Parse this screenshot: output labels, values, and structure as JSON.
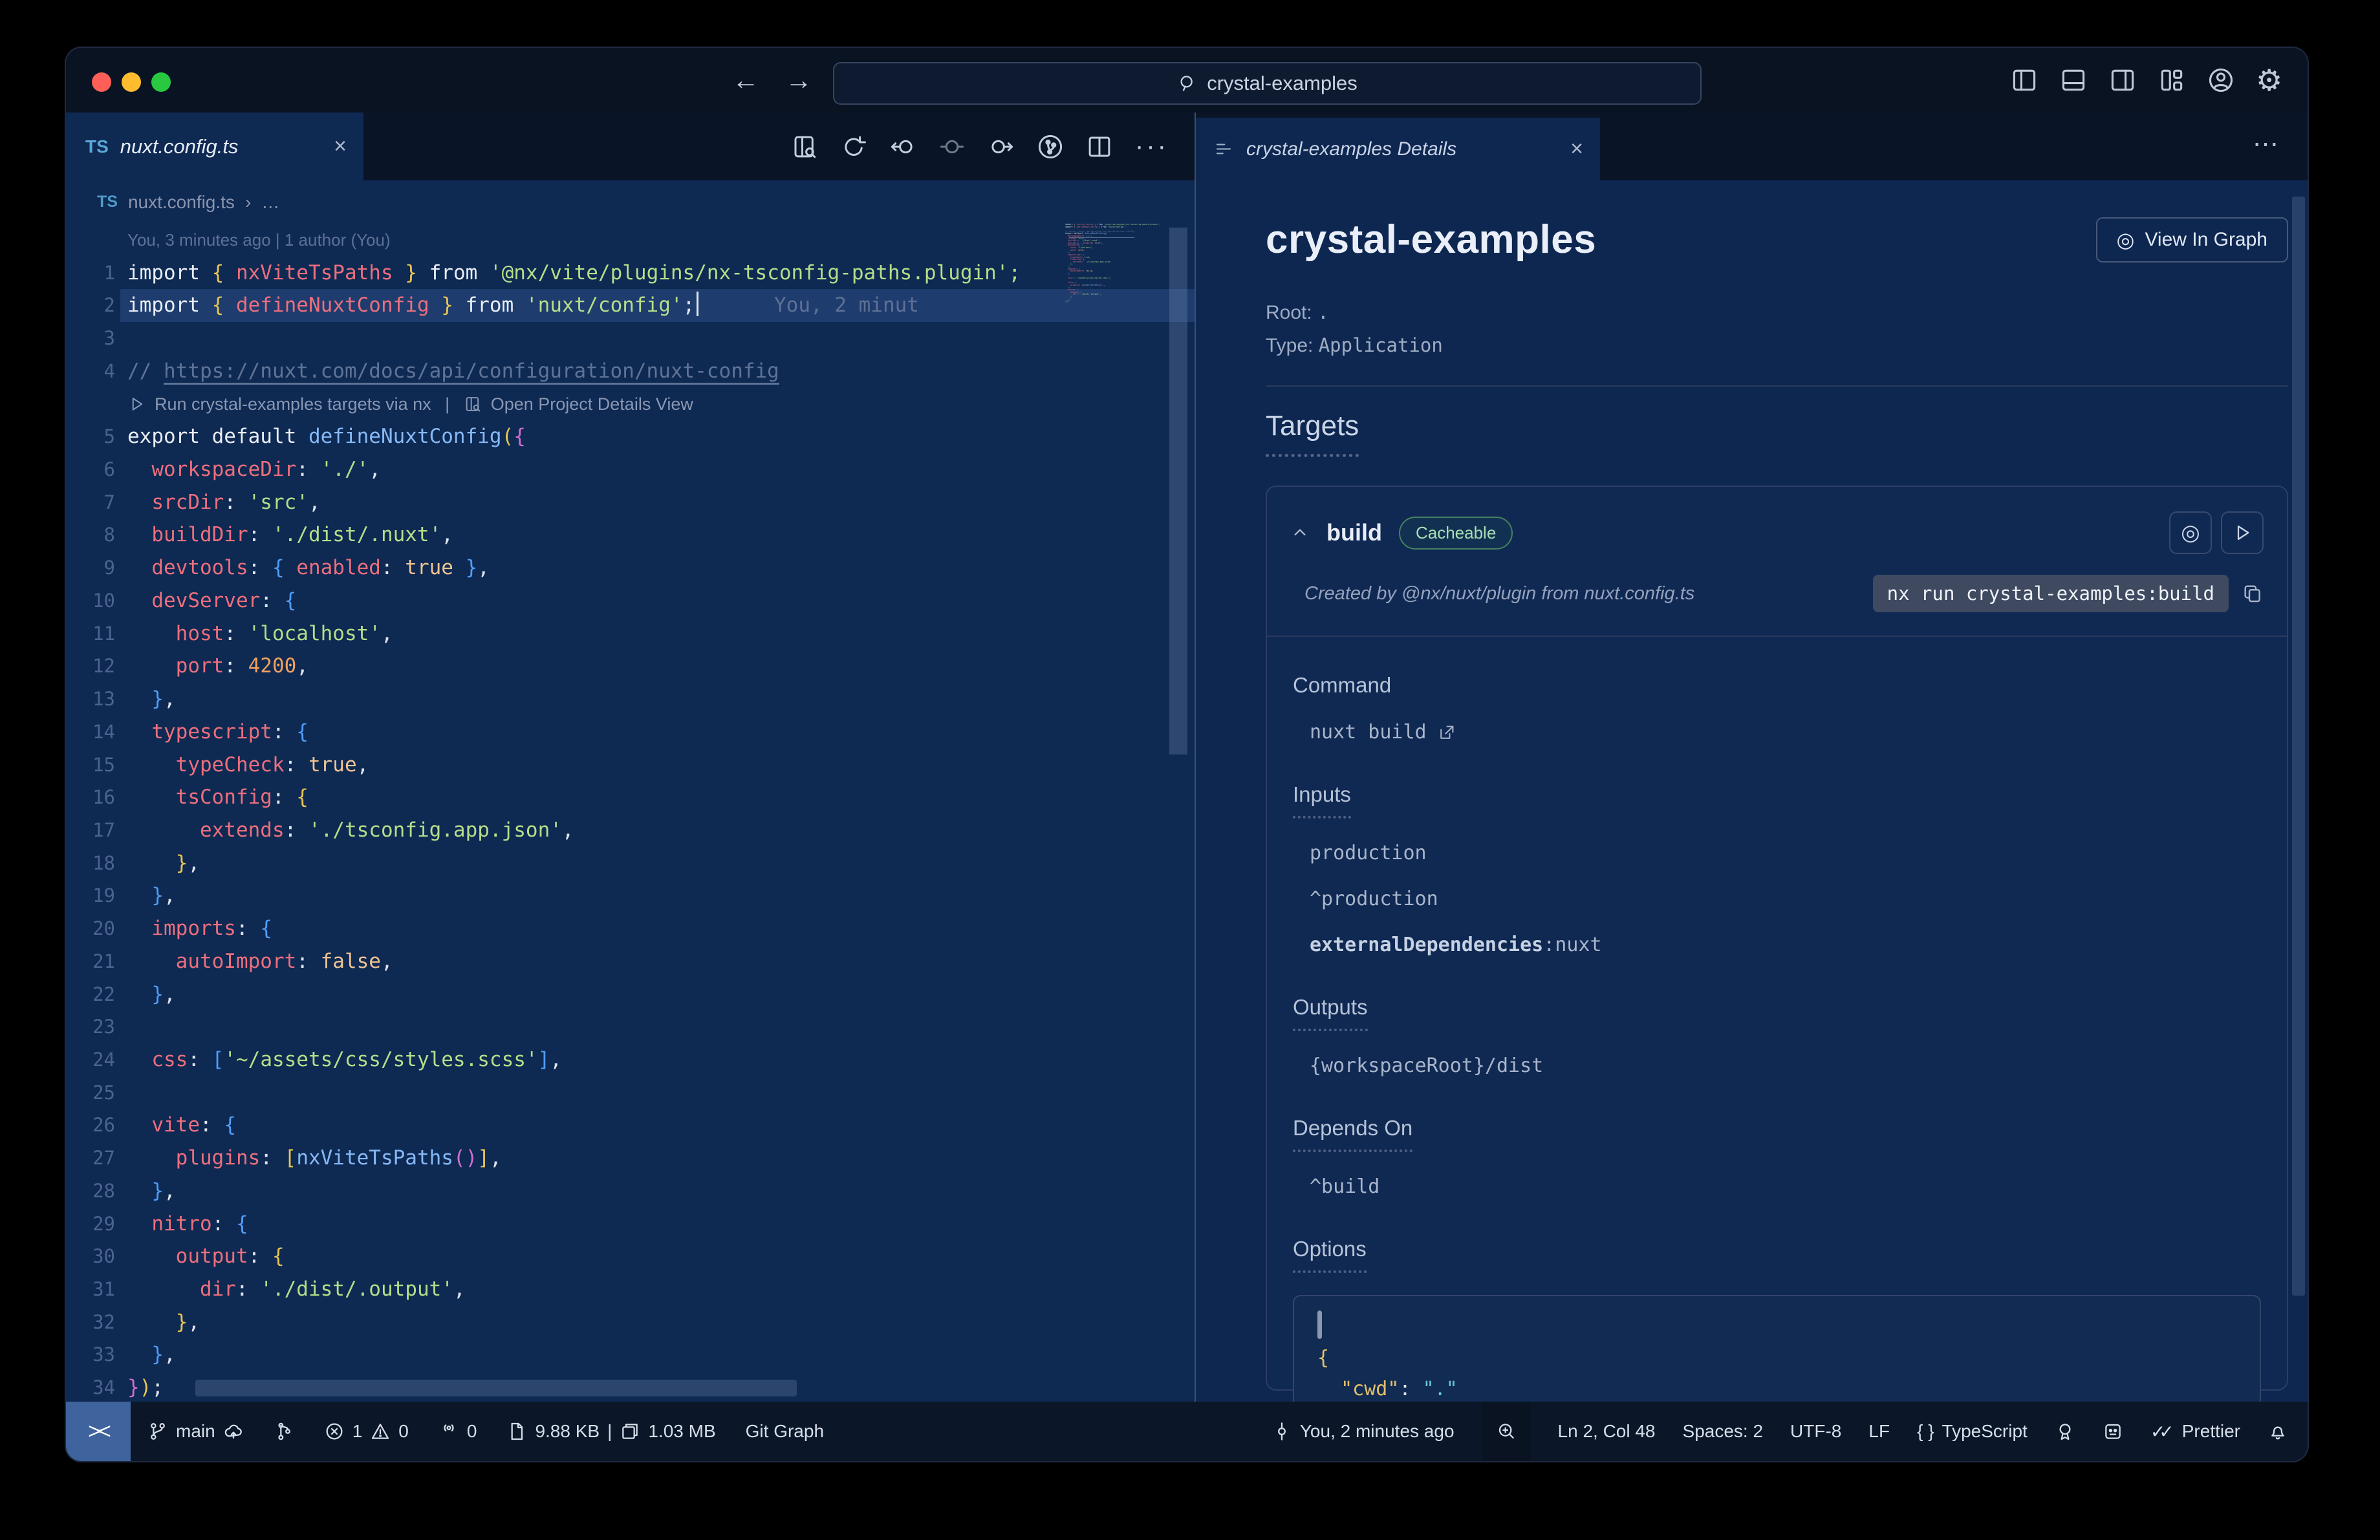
{
  "titlebar": {
    "search": "crystal-examples"
  },
  "editor_tab": {
    "badge": "TS",
    "label": "nuxt.config.ts",
    "close": "×"
  },
  "breadcrumb": {
    "badge": "TS",
    "file": "nuxt.config.ts",
    "sep": "›",
    "more": "…"
  },
  "editor": {
    "blame": "You, 3 minutes ago | 1 author (You)",
    "ghost": "You, 2 minut",
    "codelens": {
      "run": "Run crystal-examples targets via nx",
      "divider": "|",
      "open": "Open Project Details View"
    },
    "lines": [
      {
        "type": "blame"
      },
      {
        "n": 1,
        "t": [
          [
            "kw",
            "import "
          ],
          [
            "b1",
            "{ "
          ],
          [
            "id",
            "nxViteTsPaths"
          ],
          [
            "b1",
            " }"
          ],
          [
            "kw",
            " from "
          ],
          [
            "str",
            "'@nx/vite/plugins/nx-tsconfig-paths.plugin';"
          ]
        ]
      },
      {
        "n": 2,
        "hl": true,
        "cursor": true,
        "ghost": true,
        "t": [
          [
            "kw",
            "import "
          ],
          [
            "b1",
            "{ "
          ],
          [
            "id",
            "defineNuxtConfig"
          ],
          [
            "b1",
            " }"
          ],
          [
            "kw",
            " from "
          ],
          [
            "str",
            "'nuxt/config'"
          ],
          [
            "punc",
            ";"
          ]
        ]
      },
      {
        "n": 3,
        "t": []
      },
      {
        "n": 4,
        "t": [
          [
            "com",
            "// "
          ],
          [
            "comlink",
            "https://nuxt.com/docs/api/configuration/nuxt-config"
          ]
        ]
      },
      {
        "type": "codelens"
      },
      {
        "n": 5,
        "t": [
          [
            "kw",
            "export default "
          ],
          [
            "fn",
            "defineNuxtConfig"
          ],
          [
            "b1",
            "("
          ],
          [
            "b3",
            "{"
          ]
        ]
      },
      {
        "n": 6,
        "t": [
          [
            "pln",
            "  "
          ],
          [
            "prop",
            "workspaceDir"
          ],
          [
            "punc",
            ": "
          ],
          [
            "str",
            "'./'"
          ],
          [
            "punc",
            ","
          ]
        ]
      },
      {
        "n": 7,
        "t": [
          [
            "pln",
            "  "
          ],
          [
            "prop",
            "srcDir"
          ],
          [
            "punc",
            ": "
          ],
          [
            "str",
            "'src'"
          ],
          [
            "punc",
            ","
          ]
        ]
      },
      {
        "n": 8,
        "t": [
          [
            "pln",
            "  "
          ],
          [
            "prop",
            "buildDir"
          ],
          [
            "punc",
            ": "
          ],
          [
            "str",
            "'./dist/.nuxt'"
          ],
          [
            "punc",
            ","
          ]
        ]
      },
      {
        "n": 9,
        "t": [
          [
            "pln",
            "  "
          ],
          [
            "prop",
            "devtools"
          ],
          [
            "punc",
            ": "
          ],
          [
            "b2",
            "{ "
          ],
          [
            "prop",
            "enabled"
          ],
          [
            "punc",
            ": "
          ],
          [
            "bool",
            "true"
          ],
          [
            "b2",
            " }"
          ],
          [
            "punc",
            ","
          ]
        ]
      },
      {
        "n": 10,
        "t": [
          [
            "pln",
            "  "
          ],
          [
            "prop",
            "devServer"
          ],
          [
            "punc",
            ": "
          ],
          [
            "b2",
            "{"
          ]
        ]
      },
      {
        "n": 11,
        "t": [
          [
            "pln",
            "    "
          ],
          [
            "prop",
            "host"
          ],
          [
            "punc",
            ": "
          ],
          [
            "str",
            "'localhost'"
          ],
          [
            "punc",
            ","
          ]
        ]
      },
      {
        "n": 12,
        "t": [
          [
            "pln",
            "    "
          ],
          [
            "prop",
            "port"
          ],
          [
            "punc",
            ": "
          ],
          [
            "num",
            "4200"
          ],
          [
            "punc",
            ","
          ]
        ]
      },
      {
        "n": 13,
        "t": [
          [
            "pln",
            "  "
          ],
          [
            "b2",
            "}"
          ],
          [
            "punc",
            ","
          ]
        ]
      },
      {
        "n": 14,
        "t": [
          [
            "pln",
            "  "
          ],
          [
            "prop",
            "typescript"
          ],
          [
            "punc",
            ": "
          ],
          [
            "b2",
            "{"
          ]
        ]
      },
      {
        "n": 15,
        "t": [
          [
            "pln",
            "    "
          ],
          [
            "prop",
            "typeCheck"
          ],
          [
            "punc",
            ": "
          ],
          [
            "bool",
            "true"
          ],
          [
            "punc",
            ","
          ]
        ]
      },
      {
        "n": 16,
        "t": [
          [
            "pln",
            "    "
          ],
          [
            "prop",
            "tsConfig"
          ],
          [
            "punc",
            ": "
          ],
          [
            "b1",
            "{"
          ]
        ]
      },
      {
        "n": 17,
        "t": [
          [
            "pln",
            "      "
          ],
          [
            "prop",
            "extends"
          ],
          [
            "punc",
            ": "
          ],
          [
            "str",
            "'./tsconfig.app.json'"
          ],
          [
            "punc",
            ","
          ]
        ]
      },
      {
        "n": 18,
        "t": [
          [
            "pln",
            "    "
          ],
          [
            "b1",
            "}"
          ],
          [
            "punc",
            ","
          ]
        ]
      },
      {
        "n": 19,
        "t": [
          [
            "pln",
            "  "
          ],
          [
            "b2",
            "}"
          ],
          [
            "punc",
            ","
          ]
        ]
      },
      {
        "n": 20,
        "t": [
          [
            "pln",
            "  "
          ],
          [
            "prop",
            "imports"
          ],
          [
            "punc",
            ": "
          ],
          [
            "b2",
            "{"
          ]
        ]
      },
      {
        "n": 21,
        "t": [
          [
            "pln",
            "    "
          ],
          [
            "prop",
            "autoImport"
          ],
          [
            "punc",
            ": "
          ],
          [
            "bool",
            "false"
          ],
          [
            "punc",
            ","
          ]
        ]
      },
      {
        "n": 22,
        "t": [
          [
            "pln",
            "  "
          ],
          [
            "b2",
            "}"
          ],
          [
            "punc",
            ","
          ]
        ]
      },
      {
        "n": 23,
        "t": []
      },
      {
        "n": 24,
        "t": [
          [
            "pln",
            "  "
          ],
          [
            "prop",
            "css"
          ],
          [
            "punc",
            ": "
          ],
          [
            "b2",
            "["
          ],
          [
            "str",
            "'~/assets/css/styles.scss'"
          ],
          [
            "b2",
            "]"
          ],
          [
            "punc",
            ","
          ]
        ]
      },
      {
        "n": 25,
        "t": []
      },
      {
        "n": 26,
        "t": [
          [
            "pln",
            "  "
          ],
          [
            "prop",
            "vite"
          ],
          [
            "punc",
            ": "
          ],
          [
            "b2",
            "{"
          ]
        ]
      },
      {
        "n": 27,
        "t": [
          [
            "pln",
            "    "
          ],
          [
            "prop",
            "plugins"
          ],
          [
            "punc",
            ": "
          ],
          [
            "b1",
            "["
          ],
          [
            "fn",
            "nxViteTsPaths"
          ],
          [
            "b3",
            "()"
          ],
          [
            "b1",
            "]"
          ],
          [
            "punc",
            ","
          ]
        ]
      },
      {
        "n": 28,
        "t": [
          [
            "pln",
            "  "
          ],
          [
            "b2",
            "}"
          ],
          [
            "punc",
            ","
          ]
        ]
      },
      {
        "n": 29,
        "t": [
          [
            "pln",
            "  "
          ],
          [
            "prop",
            "nitro"
          ],
          [
            "punc",
            ": "
          ],
          [
            "b2",
            "{"
          ]
        ]
      },
      {
        "n": 30,
        "t": [
          [
            "pln",
            "    "
          ],
          [
            "prop",
            "output"
          ],
          [
            "punc",
            ": "
          ],
          [
            "b1",
            "{"
          ]
        ]
      },
      {
        "n": 31,
        "t": [
          [
            "pln",
            "      "
          ],
          [
            "prop",
            "dir"
          ],
          [
            "punc",
            ": "
          ],
          [
            "str",
            "'./dist/.output'"
          ],
          [
            "punc",
            ","
          ]
        ]
      },
      {
        "n": 32,
        "t": [
          [
            "pln",
            "    "
          ],
          [
            "b1",
            "}"
          ],
          [
            "punc",
            ","
          ]
        ]
      },
      {
        "n": 33,
        "t": [
          [
            "pln",
            "  "
          ],
          [
            "b2",
            "}"
          ],
          [
            "punc",
            ","
          ]
        ]
      },
      {
        "n": 34,
        "t": [
          [
            "b3",
            "}"
          ],
          [
            "b1",
            ")"
          ],
          [
            "punc",
            ";"
          ]
        ]
      }
    ]
  },
  "panel": {
    "tab": {
      "label": "crystal-examples Details",
      "close": "×",
      "more": "⋯"
    },
    "title": "crystal-examples",
    "view_in_graph": {
      "icon": "◎",
      "label": "View In Graph"
    },
    "root_label": "Root:",
    "root_value": ".",
    "type_label": "Type:",
    "type_value": "Application",
    "targets_heading": "Targets",
    "target": {
      "name": "build",
      "badge": "Cacheable",
      "created_by": "Created by @nx/nuxt/plugin from nuxt.config.ts",
      "command_chip": "nx run crystal-examples:build",
      "command_heading": "Command",
      "command_value": "nuxt build",
      "inputs_heading": "Inputs",
      "inputs": [
        "production",
        "^production"
      ],
      "inputs_kv": {
        "key": "externalDependencies",
        "sep": ": ",
        "value": "nuxt"
      },
      "outputs_heading": "Outputs",
      "outputs": [
        "{workspaceRoot}/dist"
      ],
      "depends_heading": "Depends On",
      "depends": [
        "^build"
      ],
      "options_heading": "Options",
      "options_code": {
        "open": "{",
        "key": "\"cwd\"",
        "sep": ": ",
        "value": "\".\"",
        "close": "}"
      }
    }
  },
  "status_bar": {
    "remote": "><",
    "branch": "main",
    "errors": "1",
    "warnings": "0",
    "ports": "0",
    "file_size": "9.88 KB",
    "sep": "|",
    "mem": "1.03 MB",
    "git_graph": "Git Graph",
    "blame": "You, 2 minutes ago",
    "line_col": "Ln 2, Col 48",
    "indent": "Spaces: 2",
    "encoding": "UTF-8",
    "eol": "LF",
    "lang_icon": "{ }",
    "language": "TypeScript",
    "prettier_check": "✓✓",
    "prettier": "Prettier"
  },
  "colors": {
    "editor_bg": "#0e2952",
    "panel_bg": "#0d2750",
    "titlebar_bg": "#0a1322",
    "statusbar_bg": "#0b1728",
    "remote_bg": "#3e639d",
    "cacheable_green": "#a6e0b3",
    "ts_badge_blue": "#5aa7d8",
    "string_green": "#b5de8a",
    "property_salmon": "#ec6f7e",
    "bracket_gold": "#e8c554",
    "bracket_blue": "#4f9df8",
    "bracket_magenta": "#d06fd0",
    "traffic_red": "#ff5f57",
    "traffic_yellow": "#febc2e",
    "traffic_green": "#28c840"
  }
}
